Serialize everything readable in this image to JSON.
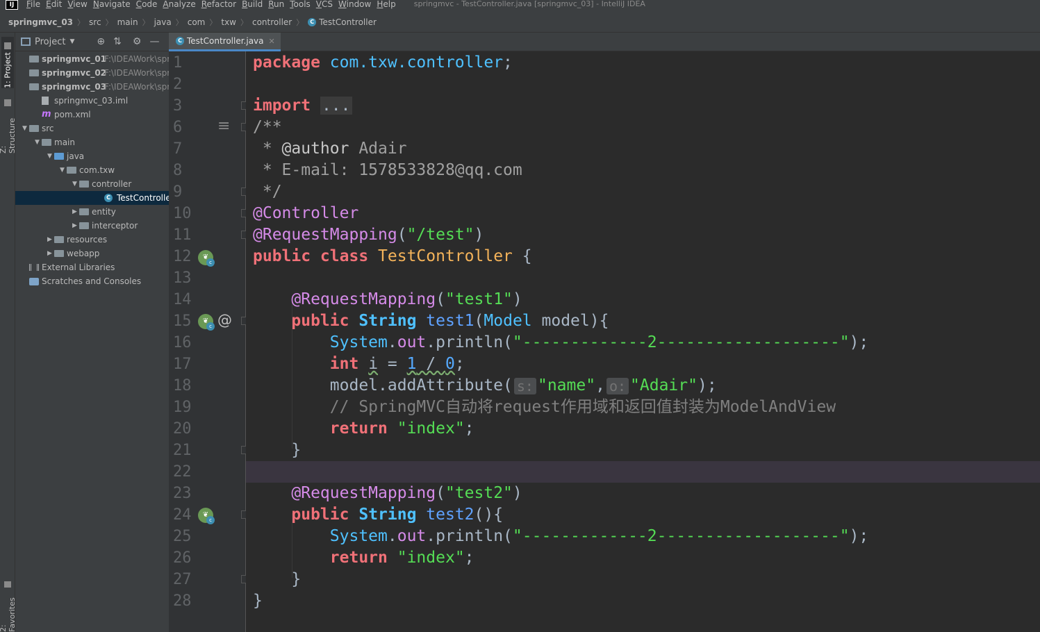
{
  "menu": {
    "logo": "IJ",
    "items": [
      "File",
      "Edit",
      "View",
      "Navigate",
      "Code",
      "Analyze",
      "Refactor",
      "Build",
      "Run",
      "Tools",
      "VCS",
      "Window",
      "Help"
    ],
    "window_title": "springmvc - TestController.java [springmvc_03] - IntelliJ IDEA"
  },
  "breadcrumbs": [
    "springmvc_03",
    "src",
    "main",
    "java",
    "com",
    "txw",
    "controller",
    "TestController"
  ],
  "left_strip": {
    "project_tab": "1: Project",
    "structure_tab": "Z: Structure",
    "favorites_tab": "2: Favorites"
  },
  "project_panel": {
    "title": "Project",
    "tree": [
      {
        "label": "springmvc_01",
        "hint": "F:\\IDEAWork\\springmvc",
        "icon": "module-folder-icon",
        "arrow": "",
        "bold": true
      },
      {
        "label": "springmvc_02",
        "hint": "F:\\IDEAWork\\springmvc",
        "icon": "module-folder-icon",
        "arrow": "",
        "bold": true
      },
      {
        "label": "springmvc_03",
        "hint": "F:\\IDEAWork\\springmvc",
        "icon": "module-folder-icon",
        "arrow": "",
        "bold": true
      },
      {
        "label": "springmvc_03.iml",
        "hint": "",
        "icon": "iml-file-icon",
        "arrow": "",
        "bold": false
      },
      {
        "label": "pom.xml",
        "hint": "",
        "icon": "maven-icon",
        "arrow": "",
        "bold": false
      },
      {
        "label": "src",
        "hint": "",
        "icon": "folder-icon",
        "arrow": "▼",
        "bold": false
      },
      {
        "label": "main",
        "hint": "",
        "icon": "folder-icon",
        "arrow": "▼",
        "bold": false
      },
      {
        "label": "java",
        "hint": "",
        "icon": "source-folder-icon",
        "arrow": "▼",
        "bold": false
      },
      {
        "label": "com.txw",
        "hint": "",
        "icon": "package-icon",
        "arrow": "▼",
        "bold": false
      },
      {
        "label": "controller",
        "hint": "",
        "icon": "package-icon",
        "arrow": "▼",
        "bold": false
      },
      {
        "label": "TestController",
        "hint": "",
        "icon": "class-icon",
        "arrow": "",
        "bold": false
      },
      {
        "label": "entity",
        "hint": "",
        "icon": "package-icon",
        "arrow": "▶",
        "bold": false
      },
      {
        "label": "interceptor",
        "hint": "",
        "icon": "package-icon",
        "arrow": "▶",
        "bold": false
      },
      {
        "label": "resources",
        "hint": "",
        "icon": "resources-folder-icon",
        "arrow": "▶",
        "bold": false
      },
      {
        "label": "webapp",
        "hint": "",
        "icon": "web-folder-icon",
        "arrow": "▶",
        "bold": false
      },
      {
        "label": "External Libraries",
        "hint": "",
        "icon": "library-icon",
        "arrow": "",
        "bold": false
      },
      {
        "label": "Scratches and Consoles",
        "hint": "",
        "icon": "scratch-icon",
        "arrow": "",
        "bold": false
      }
    ]
  },
  "editor": {
    "tab_label": "TestController.java",
    "line_numbers": [
      "1",
      "2",
      "3",
      "6",
      "7",
      "8",
      "9",
      "10",
      "11",
      "12",
      "13",
      "14",
      "15",
      "16",
      "17",
      "18",
      "19",
      "20",
      "21",
      "22",
      "23",
      "24",
      "25",
      "26",
      "27",
      "28"
    ],
    "code": {
      "l1_kw": "package",
      "l1_pkg": "com.txw.controller",
      "l1_end": ";",
      "l3_kw": "import",
      "l3_fold": "...",
      "l6": "/**",
      "l7_star": " * ",
      "l7_tag": "@author",
      "l7_text": " Adair",
      "l8_star": " * ",
      "l8_text": "E-mail: 1578533828@qq.com",
      "l9": " */",
      "l10": "@Controller",
      "l11_ann": "@RequestMapping",
      "l11_open": "(",
      "l11_str": "\"/test\"",
      "l11_close": ")",
      "l12_kw": "public class",
      "l12_cls": "TestController",
      "l12_end": " {",
      "l14_ann": "@RequestMapping",
      "l14_open": "(",
      "l14_str": "\"test1\"",
      "l14_close": ")",
      "l15_kw": "public",
      "l15_type": "String",
      "l15_name": "test1",
      "l15_p1": "(",
      "l15_ptype": "Model",
      "l15_rest": " model){",
      "l16_cls": "System",
      "l16_dot": ".",
      "l16_field": "out",
      "l16_call": ".println(",
      "l16_str": "\"-------------2-------------------\"",
      "l16_end": ");",
      "l17_kw": "int",
      "l17_var": "i",
      "l17_eq": " = ",
      "l17_a": "1",
      "l17_op": " / ",
      "l17_b": "0",
      "l17_end": ";",
      "l18_call": "model.addAttribute(",
      "l18_hint1": "s:",
      "l18_str1": "\"name\"",
      "l18_comma": ",",
      "l18_hint2": "o:",
      "l18_str2": "\"Adair\"",
      "l18_end": ");",
      "l19": "// SpringMVC自动将request作用域和返回值封装为ModelAndView",
      "l20_kw": "return",
      "l20_str": "\"index\"",
      "l20_end": ";",
      "l21": "}",
      "l23_ann": "@RequestMapping",
      "l23_open": "(",
      "l23_str": "\"test2\"",
      "l23_close": ")",
      "l24_kw": "public",
      "l24_type": "String",
      "l24_name": "test2",
      "l24_rest": "(){",
      "l25_cls": "System",
      "l25_dot": ".",
      "l25_field": "out",
      "l25_call": ".println(",
      "l25_str": "\"-------------2-------------------\"",
      "l25_end": ");",
      "l26_kw": "return",
      "l26_str": "\"index\"",
      "l26_end": ";",
      "l27": "}",
      "l28": "}"
    }
  },
  "colors": {
    "keyword": "#f07178",
    "string": "#55dd55",
    "annotation": "#d58be8",
    "type": "#4fc1ff",
    "comment": "#808080",
    "class_name": "#f4b35a"
  }
}
